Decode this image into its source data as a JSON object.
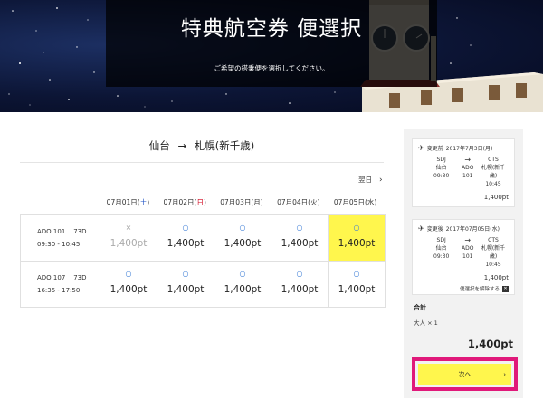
{
  "hero": {
    "title": "特典航空券 便選択",
    "subtitle": "ご希望の搭乗便を選択してください。"
  },
  "route": {
    "origin": "仙台",
    "arrow": "→",
    "destination": "札幌(新千歳)"
  },
  "next_day_label": "翌日",
  "dates": [
    {
      "label": "07月01日(",
      "day": "土",
      "suffix": ")",
      "kind": "sat"
    },
    {
      "label": "07月02日(",
      "day": "日",
      "suffix": ")",
      "kind": "sun"
    },
    {
      "label": "07月03日(",
      "day": "月",
      "suffix": ")",
      "kind": "weekday"
    },
    {
      "label": "07月04日(",
      "day": "火",
      "suffix": ")",
      "kind": "weekday"
    },
    {
      "label": "07月05日(",
      "day": "水",
      "suffix": ")",
      "kind": "weekday"
    }
  ],
  "flights": [
    {
      "flight_no": "ADO 101",
      "aircraft": "73D",
      "time": "09:30 - 10:45",
      "fares": [
        {
          "mark": "×",
          "price": "1,400pt",
          "status": "unavailable"
        },
        {
          "mark": "○",
          "price": "1,400pt",
          "status": "available"
        },
        {
          "mark": "○",
          "price": "1,400pt",
          "status": "available"
        },
        {
          "mark": "○",
          "price": "1,400pt",
          "status": "available"
        },
        {
          "mark": "○",
          "price": "1,400pt",
          "status": "selected"
        }
      ]
    },
    {
      "flight_no": "ADO 107",
      "aircraft": "73D",
      "time": "16:35 - 17:50",
      "fares": [
        {
          "mark": "○",
          "price": "1,400pt",
          "status": "available"
        },
        {
          "mark": "○",
          "price": "1,400pt",
          "status": "available"
        },
        {
          "mark": "○",
          "price": "1,400pt",
          "status": "available"
        },
        {
          "mark": "○",
          "price": "1,400pt",
          "status": "available"
        },
        {
          "mark": "○",
          "price": "1,400pt",
          "status": "available"
        }
      ]
    }
  ],
  "summary": {
    "before": {
      "label": "変更前",
      "date": "2017年7月3日(月)",
      "dep_code": "SDJ",
      "dep_city": "仙台",
      "dep_time": "09:30",
      "arrow": "→",
      "carrier": "ADO",
      "flight_no": "101",
      "arr_code": "CTS",
      "arr_city": "札幌(新千歳)",
      "arr_time": "10:45",
      "price": "1,400pt"
    },
    "after": {
      "label": "変更後",
      "date": "2017年07月05日(水)",
      "dep_code": "SDJ",
      "dep_city": "仙台",
      "dep_time": "09:30",
      "arrow": "→",
      "carrier": "ADO",
      "flight_no": "101",
      "arr_code": "CTS",
      "arr_city": "札幌(新千歳)",
      "arr_time": "10:45",
      "price": "1,400pt",
      "cancel_label": "便選択を解除する",
      "cancel_mark": "✕"
    },
    "total_label": "合計",
    "pax": "大人 × 1",
    "total_price": "1,400pt",
    "next_button": "次へ",
    "next_chevron": "›"
  },
  "colors": {
    "selected_fill": "#fff64d",
    "available_mark": "#3a7bd5",
    "saturday": "#1a4fc4",
    "sunday": "#d0021b",
    "highlight_frame": "#e0197a"
  }
}
